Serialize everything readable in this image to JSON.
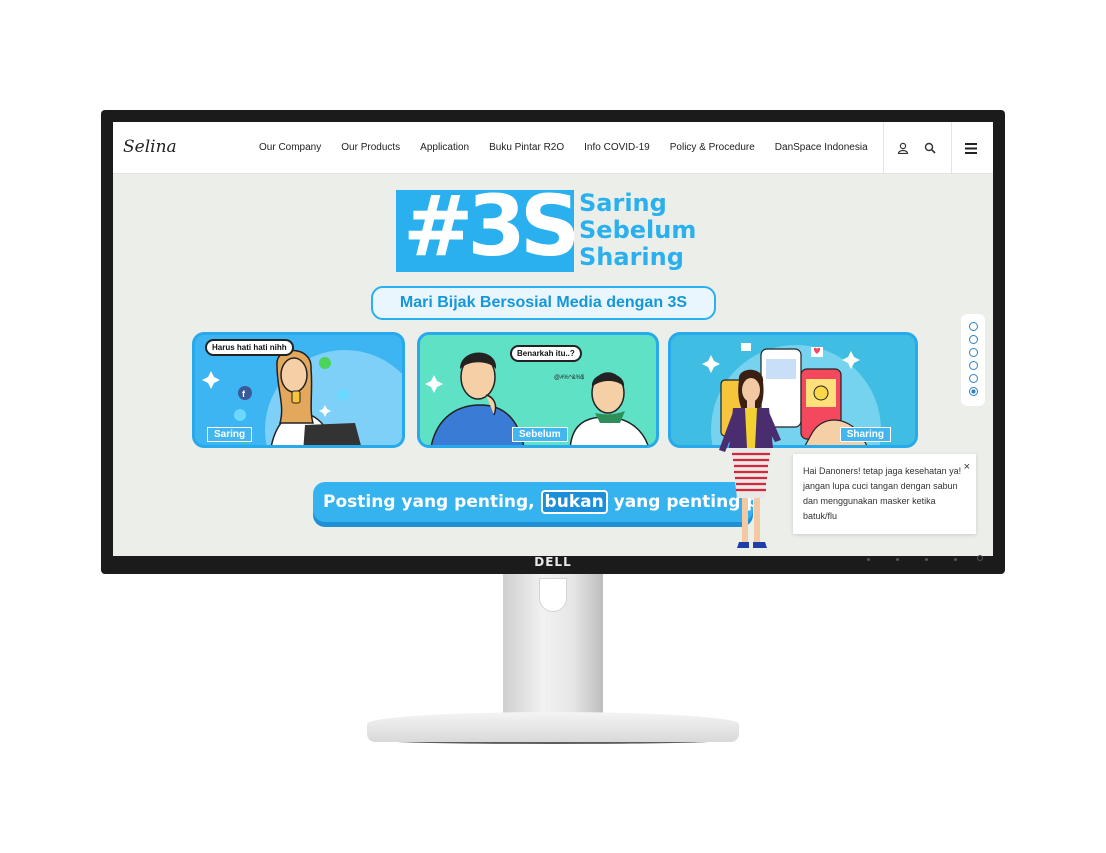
{
  "device": {
    "brand": "DELL"
  },
  "nav": {
    "logo": "Selina",
    "links": [
      "Our Company",
      "Our Products",
      "Application",
      "Buku Pintar R2O",
      "Info COVID-19",
      "Policy & Procedure",
      "DanSpace Indonesia"
    ],
    "icons": {
      "account": "user-icon",
      "search": "search-icon",
      "menu": "hamburger-menu-icon"
    }
  },
  "hero": {
    "hashtag": "#3S",
    "slogan": [
      "Saring",
      "Sebelum",
      "Sharing"
    ],
    "subtitle": "Mari Bijak Bersosial Media dengan 3S",
    "cards": [
      {
        "label": "Saring",
        "bubble": "Harus hati hati nihh"
      },
      {
        "label": "Sebelum",
        "bubble": "Benarkah itu..?",
        "small": "@#%^&%$"
      },
      {
        "label": "Sharing"
      }
    ],
    "banner": {
      "before": "Posting yang penting, ",
      "highlight": "bukan",
      "after": " yang penting posting"
    }
  },
  "pager": {
    "count": 6,
    "active_index": 5
  },
  "chat": {
    "message": "Hai Danoners! tetap jaga kesehatan ya! jangan lupa cuci tangan dengan sabun dan menggunakan masker ketika batuk/flu",
    "close": "×"
  },
  "colors": {
    "accent": "#2ab0ee",
    "screen_bg": "#ecefe9",
    "card_border": "#28a9ec"
  }
}
